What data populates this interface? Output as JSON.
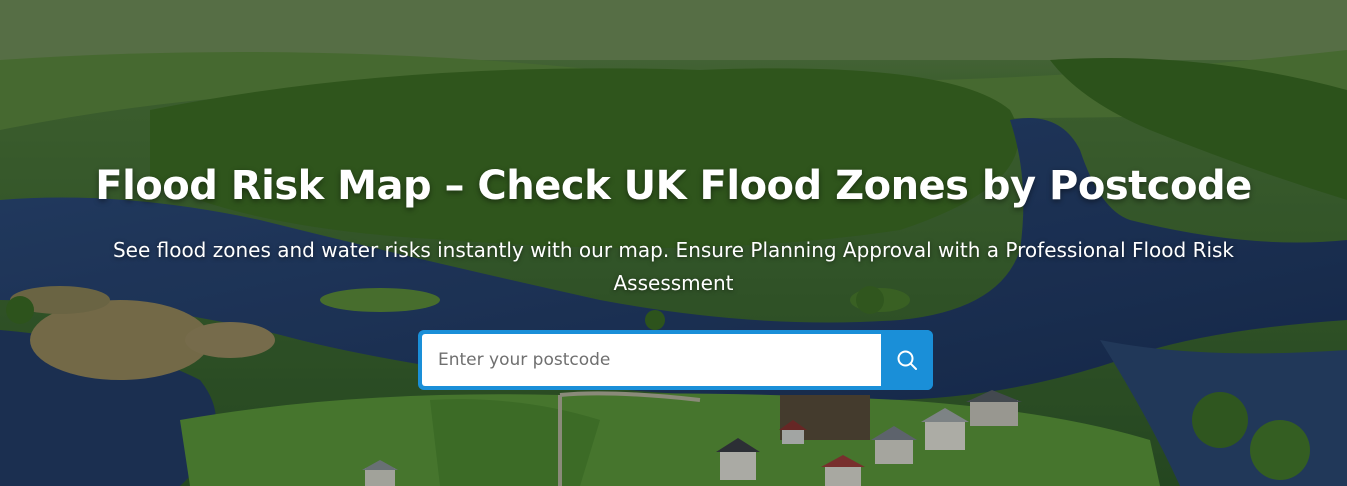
{
  "hero": {
    "title": "Flood Risk Map – Check UK Flood Zones by Postcode",
    "subtitle": "See flood zones and water risks instantly with our map. Ensure Planning Approval with a Professional Flood Risk Assessment",
    "background_image": "aerial-river-floodplain-landscape"
  },
  "search": {
    "placeholder": "Enter your postcode",
    "value": "",
    "button_icon": "search-icon"
  },
  "colors": {
    "accent": "#1a8fd8",
    "text": "#ffffff",
    "input_bg": "#ffffff",
    "placeholder": "#6f6f6f"
  }
}
